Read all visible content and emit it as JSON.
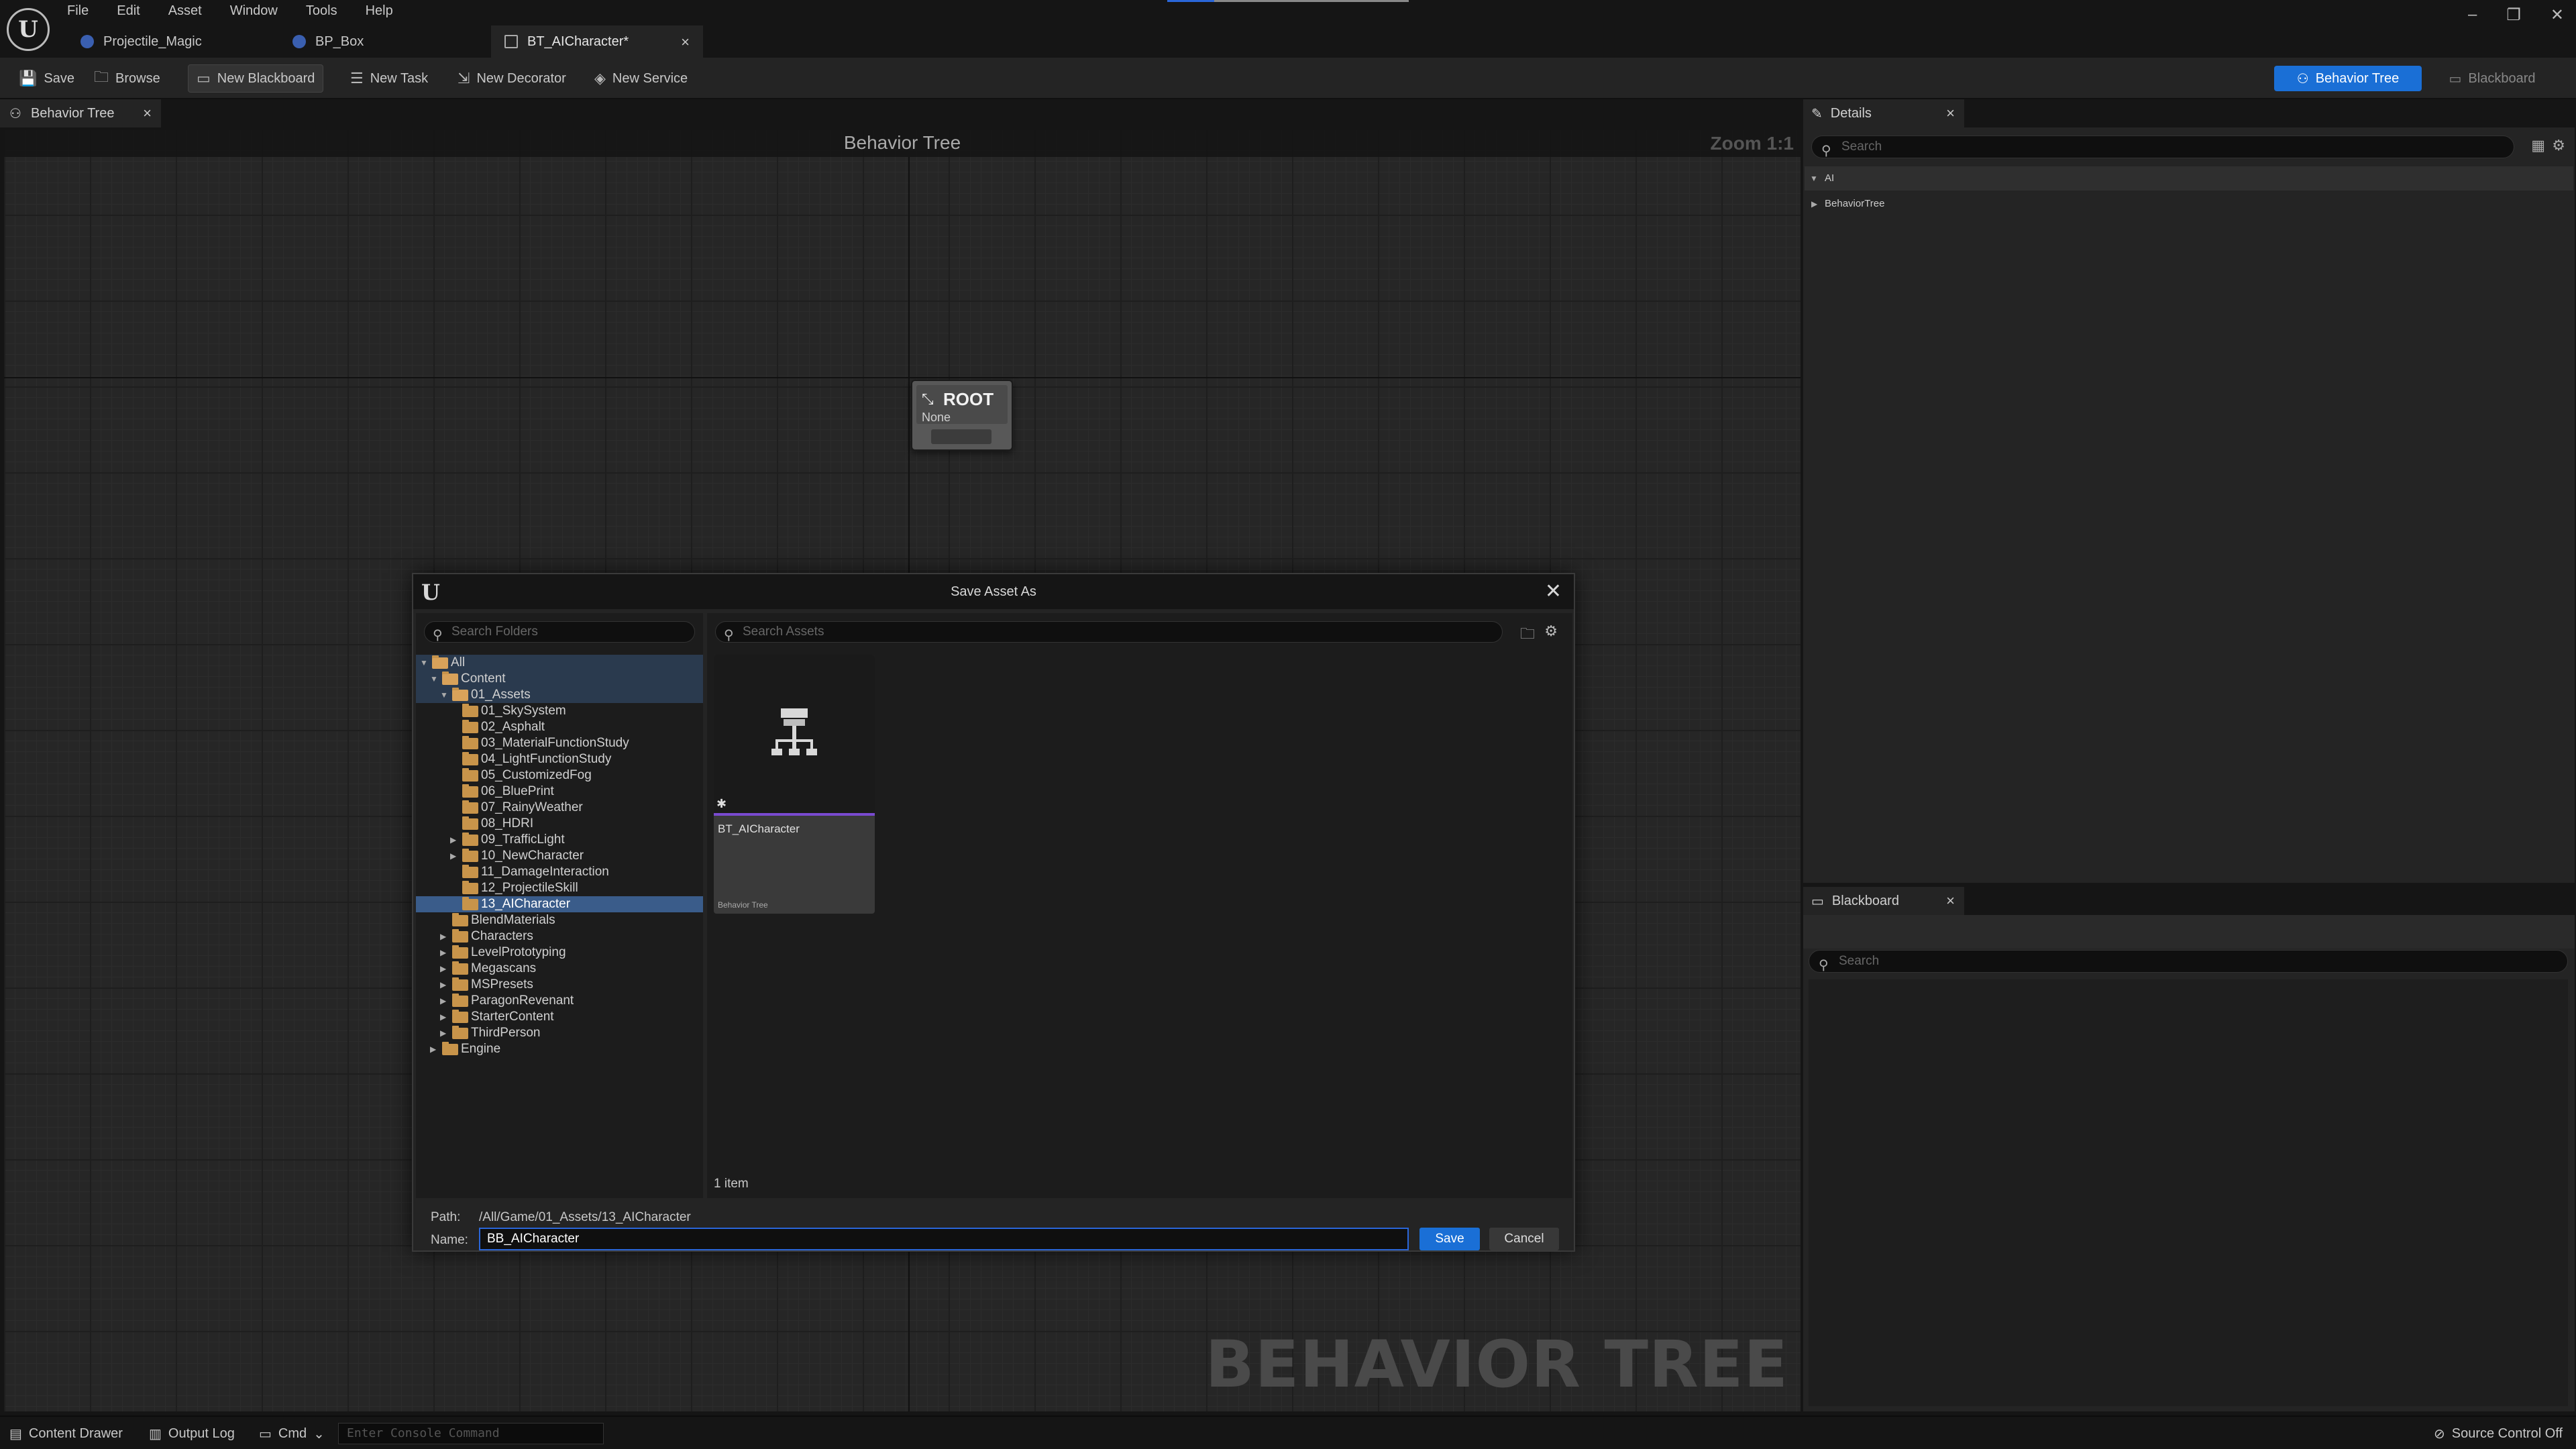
{
  "menu": [
    "File",
    "Edit",
    "Asset",
    "Window",
    "Tools",
    "Help"
  ],
  "doc_tabs": [
    {
      "label": "Projectile_Magic",
      "icon": "blueprint-icon"
    },
    {
      "label": "BP_Box",
      "icon": "blueprint-icon"
    },
    {
      "label": "BT_AICharacter*",
      "icon": "behavior-tree-icon",
      "active": true
    }
  ],
  "window_controls": {
    "minimize": "–",
    "restore": "❐",
    "close": "✕"
  },
  "toolbar": {
    "save": "Save",
    "browse": "Browse",
    "new_blackboard": "New Blackboard",
    "new_task": "New Task",
    "new_decorator": "New Decorator",
    "new_service": "New Service",
    "mode_behavior_tree": "Behavior Tree",
    "mode_blackboard": "Blackboard"
  },
  "graph": {
    "tab_label": "Behavior Tree",
    "title": "Behavior Tree",
    "zoom": "Zoom 1:1",
    "root_node": {
      "title": "ROOT",
      "subtitle": "None"
    },
    "watermark": "BEHAVIOR TREE"
  },
  "details": {
    "tab_label": "Details",
    "search_placeholder": "Search",
    "category": "AI",
    "row": "BehaviorTree"
  },
  "blackboard": {
    "tab_label": "Blackboard",
    "search_placeholder": "Search"
  },
  "statusbar": {
    "content_drawer": "Content Drawer",
    "output_log": "Output Log",
    "cmd": "Cmd",
    "console_placeholder": "Enter Console Command",
    "source_control": "Source Control Off"
  },
  "dialog": {
    "title": "Save Asset As",
    "folder_search_placeholder": "Search Folders",
    "asset_search_placeholder": "Search Assets",
    "folders": [
      {
        "label": "All",
        "depth": 0,
        "expanded": true,
        "highlight": true
      },
      {
        "label": "Content",
        "depth": 1,
        "expanded": true,
        "highlight": true
      },
      {
        "label": "01_Assets",
        "depth": 2,
        "expanded": true,
        "highlight": true
      },
      {
        "label": "01_SkySystem",
        "depth": 3
      },
      {
        "label": "02_Asphalt",
        "depth": 3
      },
      {
        "label": "03_MaterialFunctionStudy",
        "depth": 3
      },
      {
        "label": "04_LightFunctionStudy",
        "depth": 3
      },
      {
        "label": "05_CustomizedFog",
        "depth": 3
      },
      {
        "label": "06_BluePrint",
        "depth": 3
      },
      {
        "label": "07_RainyWeather",
        "depth": 3
      },
      {
        "label": "08_HDRI",
        "depth": 3
      },
      {
        "label": "09_TrafficLight",
        "depth": 3,
        "collapsed": true
      },
      {
        "label": "10_NewCharacter",
        "depth": 3,
        "collapsed": true
      },
      {
        "label": "11_DamageInteraction",
        "depth": 3
      },
      {
        "label": "12_ProjectileSkill",
        "depth": 3
      },
      {
        "label": "13_AICharacter",
        "depth": 3,
        "selected": true
      },
      {
        "label": "BlendMaterials",
        "depth": 2
      },
      {
        "label": "Characters",
        "depth": 2,
        "collapsed": true
      },
      {
        "label": "LevelPrototyping",
        "depth": 2,
        "collapsed": true
      },
      {
        "label": "Megascans",
        "depth": 2,
        "collapsed": true
      },
      {
        "label": "MSPresets",
        "depth": 2,
        "collapsed": true
      },
      {
        "label": "ParagonRevenant",
        "depth": 2,
        "collapsed": true
      },
      {
        "label": "StarterContent",
        "depth": 2,
        "collapsed": true
      },
      {
        "label": "ThirdPerson",
        "depth": 2,
        "collapsed": true
      },
      {
        "label": "Engine",
        "depth": 1,
        "collapsed": true
      }
    ],
    "asset": {
      "name": "BT_AICharacter",
      "type": "Behavior Tree"
    },
    "item_count": "1 item",
    "path_label": "Path:",
    "path_value": "/All/Game/01_Assets/13_AICharacter",
    "name_label": "Name:",
    "name_value": "BB_AICharacter",
    "save_label": "Save",
    "cancel_label": "Cancel"
  }
}
